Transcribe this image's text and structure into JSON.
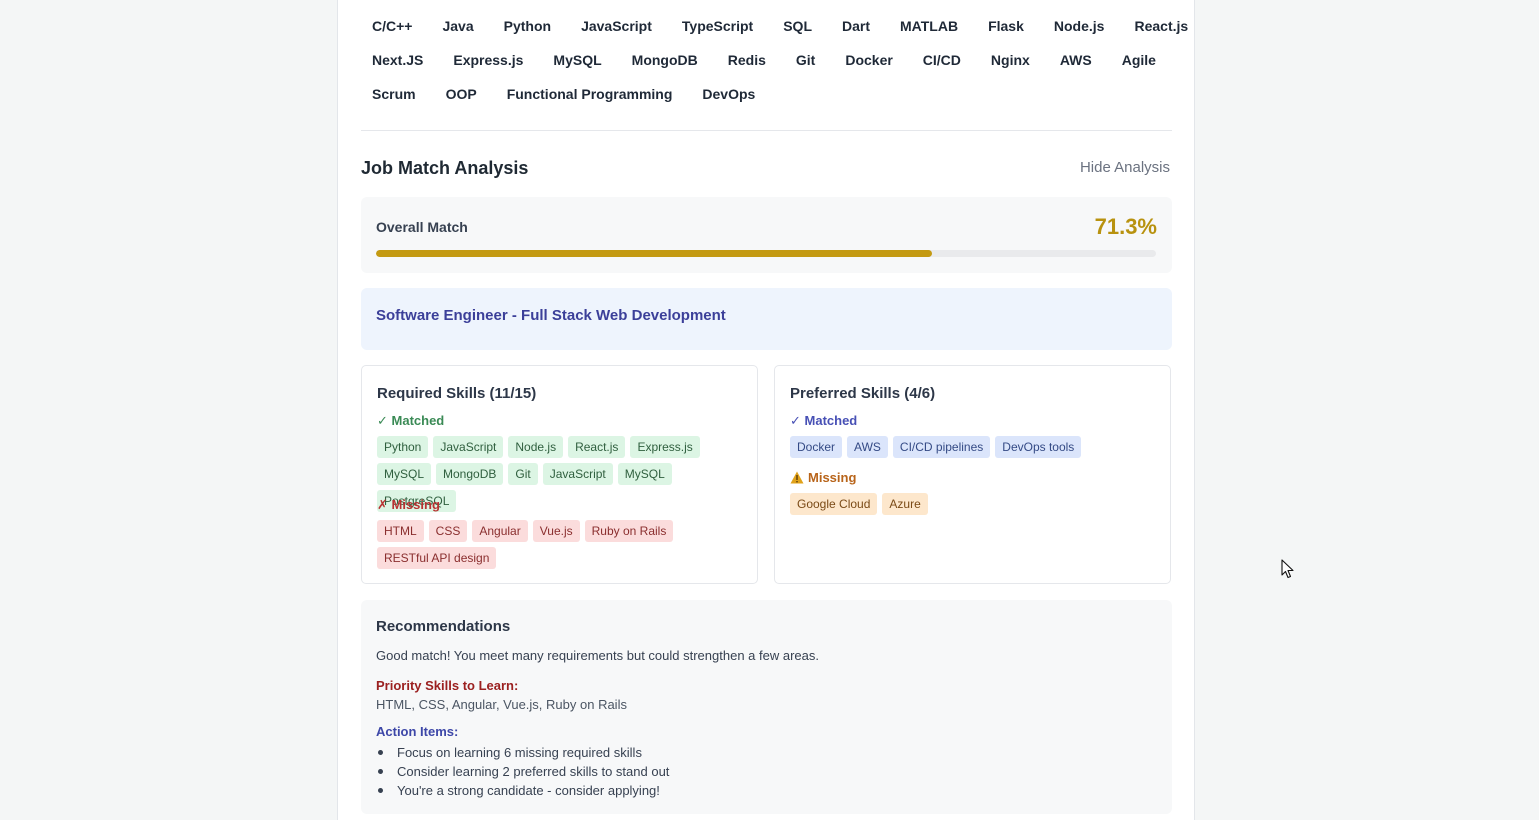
{
  "skills": {
    "row1": [
      "C/C++",
      "Java",
      "Python",
      "JavaScript",
      "TypeScript",
      "SQL",
      "Dart",
      "MATLAB",
      "Flask",
      "Node.js",
      "React.js"
    ],
    "row2": [
      "Next.JS",
      "Express.js",
      "MySQL",
      "MongoDB",
      "Redis",
      "Git",
      "Docker",
      "CI/CD",
      "Nginx",
      "AWS",
      "Agile"
    ],
    "row3": [
      "Scrum",
      "OOP",
      "Functional Programming",
      "DevOps"
    ]
  },
  "analysis": {
    "title": "Job Match Analysis",
    "hide_label": "Hide Analysis",
    "overall_label": "Overall Match",
    "overall_value": "71.3%",
    "overall_fraction": 0.713,
    "job_title": "Software Engineer - Full Stack Web Development",
    "colors": {
      "match_accent": "#b8920f",
      "progress_fill": "#c49a12"
    }
  },
  "required": {
    "title": "Required Skills (11/15)",
    "matched_label": "✓ Matched",
    "matched": [
      "Python",
      "JavaScript",
      "Node.js",
      "React.js",
      "Express.js",
      "MySQL",
      "MongoDB",
      "Git",
      "JavaScript",
      "MySQL",
      "PostgreSQL"
    ],
    "missing_label": "✗ Missing",
    "missing": [
      "HTML",
      "CSS",
      "Angular",
      "Vue.js",
      "Ruby on Rails",
      "RESTful API design"
    ]
  },
  "preferred": {
    "title": "Preferred Skills (4/6)",
    "matched_label": "✓ Matched",
    "matched": [
      "Docker",
      "AWS",
      "CI/CD pipelines",
      "DevOps tools"
    ],
    "missing_icon": "warning-icon",
    "missing_label": "Missing",
    "missing": [
      "Google Cloud",
      "Azure"
    ]
  },
  "recommendations": {
    "title": "Recommendations",
    "summary": "Good match! You meet many requirements but could strengthen a few areas.",
    "priority_label": "Priority Skills to Learn:",
    "priority_skills": "HTML, CSS, Angular, Vue.js, Ruby on Rails",
    "action_label": "Action Items:",
    "actions": [
      "Focus on learning 6 missing required skills",
      "Consider learning 2 preferred skills to stand out",
      "You're a strong candidate - consider applying!"
    ]
  }
}
